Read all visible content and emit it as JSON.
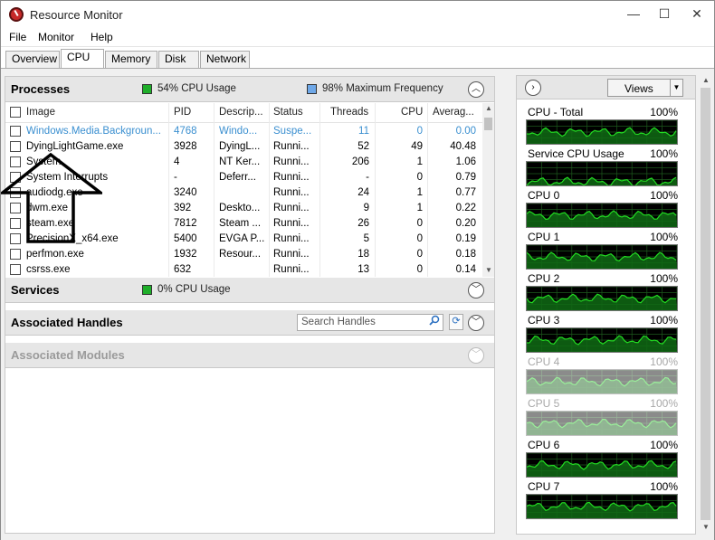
{
  "window": {
    "title": "Resource Monitor",
    "controls": {
      "minimize": "—",
      "maximize": "☐",
      "close": "✕"
    }
  },
  "menu": [
    "File",
    "Monitor",
    "Help"
  ],
  "tabs": [
    "Overview",
    "CPU",
    "Memory",
    "Disk",
    "Network"
  ],
  "active_tab": "CPU",
  "processes": {
    "title": "Processes",
    "cpu_usage": "54% CPU Usage",
    "max_frequency": "98% Maximum Frequency",
    "columns": [
      "Image",
      "PID",
      "Descrip...",
      "Status",
      "Threads",
      "CPU",
      "Averag..."
    ],
    "rows": [
      {
        "image": "Windows.Media.Backgroun...",
        "pid": "4768",
        "desc": "Windo...",
        "status": "Suspe...",
        "threads": "11",
        "cpu": "0",
        "avg": "0.00",
        "suspended": true
      },
      {
        "image": "DyingLightGame.exe",
        "pid": "3928",
        "desc": "DyingL...",
        "status": "Runni...",
        "threads": "52",
        "cpu": "49",
        "avg": "40.48"
      },
      {
        "image": "System",
        "pid": "4",
        "desc": "NT Ker...",
        "status": "Runni...",
        "threads": "206",
        "cpu": "1",
        "avg": "1.06"
      },
      {
        "image": "System Interrupts",
        "pid": "-",
        "desc": "Deferr...",
        "status": "Runni...",
        "threads": "-",
        "cpu": "0",
        "avg": "0.79"
      },
      {
        "image": "audiodg.exe",
        "pid": "3240",
        "desc": "",
        "status": "Runni...",
        "threads": "24",
        "cpu": "1",
        "avg": "0.77"
      },
      {
        "image": "dwm.exe",
        "pid": "392",
        "desc": "Deskto...",
        "status": "Runni...",
        "threads": "9",
        "cpu": "1",
        "avg": "0.22"
      },
      {
        "image": "steam.exe",
        "pid": "7812",
        "desc": "Steam ...",
        "status": "Runni...",
        "threads": "26",
        "cpu": "0",
        "avg": "0.20"
      },
      {
        "image": "PrecisionX_x64.exe",
        "pid": "5400",
        "desc": "EVGA P...",
        "status": "Runni...",
        "threads": "5",
        "cpu": "0",
        "avg": "0.19"
      },
      {
        "image": "perfmon.exe",
        "pid": "1932",
        "desc": "Resour...",
        "status": "Runni...",
        "threads": "18",
        "cpu": "0",
        "avg": "0.18"
      },
      {
        "image": "csrss.exe",
        "pid": "632",
        "desc": "",
        "status": "Runni...",
        "threads": "13",
        "cpu": "0",
        "avg": "0.14"
      }
    ]
  },
  "services": {
    "title": "Services",
    "cpu_usage": "0% CPU Usage"
  },
  "handles": {
    "title": "Associated Handles",
    "search_placeholder": "Search Handles"
  },
  "modules": {
    "title": "Associated Modules"
  },
  "right_panel": {
    "views_label": "Views",
    "graphs": [
      {
        "label": "CPU - Total",
        "pct": "100%",
        "dim": false
      },
      {
        "label": "Service CPU Usage",
        "pct": "100%",
        "dim": false
      },
      {
        "label": "CPU 0",
        "pct": "100%",
        "dim": false
      },
      {
        "label": "CPU 1",
        "pct": "100%",
        "dim": false
      },
      {
        "label": "CPU 2",
        "pct": "100%",
        "dim": false
      },
      {
        "label": "CPU 3",
        "pct": "100%",
        "dim": false
      },
      {
        "label": "CPU 4",
        "pct": "100%",
        "dim": true
      },
      {
        "label": "CPU 5",
        "pct": "100%",
        "dim": true
      },
      {
        "label": "CPU 6",
        "pct": "100%",
        "dim": false
      },
      {
        "label": "CPU 7",
        "pct": "100%",
        "dim": false
      }
    ]
  },
  "colors": {
    "cpu_usage_swatch": "#1fae2a",
    "max_freq_swatch": "#6fa8e8",
    "graph_line": "#22dd22",
    "suspended_text": "#3a8fd0"
  }
}
